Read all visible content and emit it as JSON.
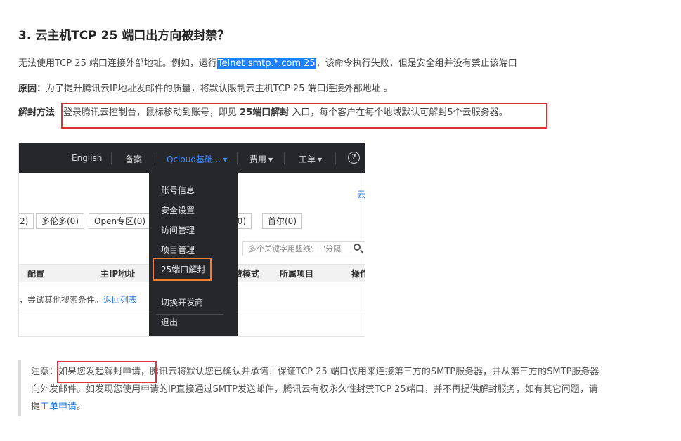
{
  "heading": "3. 云主机TCP 25 端口出方向被封禁？",
  "p1": {
    "before": "无法使用TCP 25 端口连接外部地址。例如，运行",
    "highlight": "Telnet smtp.*.com 25",
    "after": "，该命令执行失败，但是安全组并没有禁止该端口"
  },
  "p2": {
    "label": "原因：",
    "text": "为了提升腾讯云IP地址发邮件的质量，将默认限制云主机TCP 25 端口连接外部地址 。"
  },
  "p3": {
    "label": "解封方法",
    "text_before": "登录腾讯云控制台，鼠标移动到账号，即见 ",
    "bold": "25端口解封",
    "text_after": " 入口，每个客户在每个地域默认可解封5个云服务器。"
  },
  "shot": {
    "nav": [
      "English",
      "备案",
      "Qcloud基础...",
      "费用",
      "工单"
    ],
    "help_glyph": "?",
    "right_link": "云",
    "chips": [
      "2)",
      "多伦多(0)",
      "Open专区(0)",
      "(0)",
      "首尔(0)"
    ],
    "search_placeholder": "多个关键字用竖线\"｜\"分隔",
    "columns": [
      "配置",
      "主IP地址",
      "费模式",
      "所属项目",
      "操作"
    ],
    "empty_text": "，尝试其他搜索条件。",
    "empty_link": "返回列表",
    "menu": [
      "账号信息",
      "安全设置",
      "访问管理",
      "项目管理",
      "25端口解封",
      "切换开发商",
      "退出"
    ]
  },
  "note": {
    "prefix": "注意：",
    "boxed": "如果您发起解封申请",
    "line1_rest": "，腾讯云将默认您已确认并承诺：保证TCP 25 端口仅用来连接第三方的SMTP服务器，并从第三方的SMTP服务器",
    "line2": "向外发邮件。如发现您使用申请的IP直接通过SMTP发送邮件，腾讯云有权永久性封禁TCP 25端口，并不再提供解封服务，如有其它问题，请",
    "line3_before": "提",
    "line3_link": "工单申请",
    "line3_after": "。"
  },
  "colors": {
    "highlight": "#1e80ff",
    "red_box": "#e0303a",
    "orange_box": "#f0802e",
    "link": "#2577e3",
    "topbar": "#26272b"
  }
}
